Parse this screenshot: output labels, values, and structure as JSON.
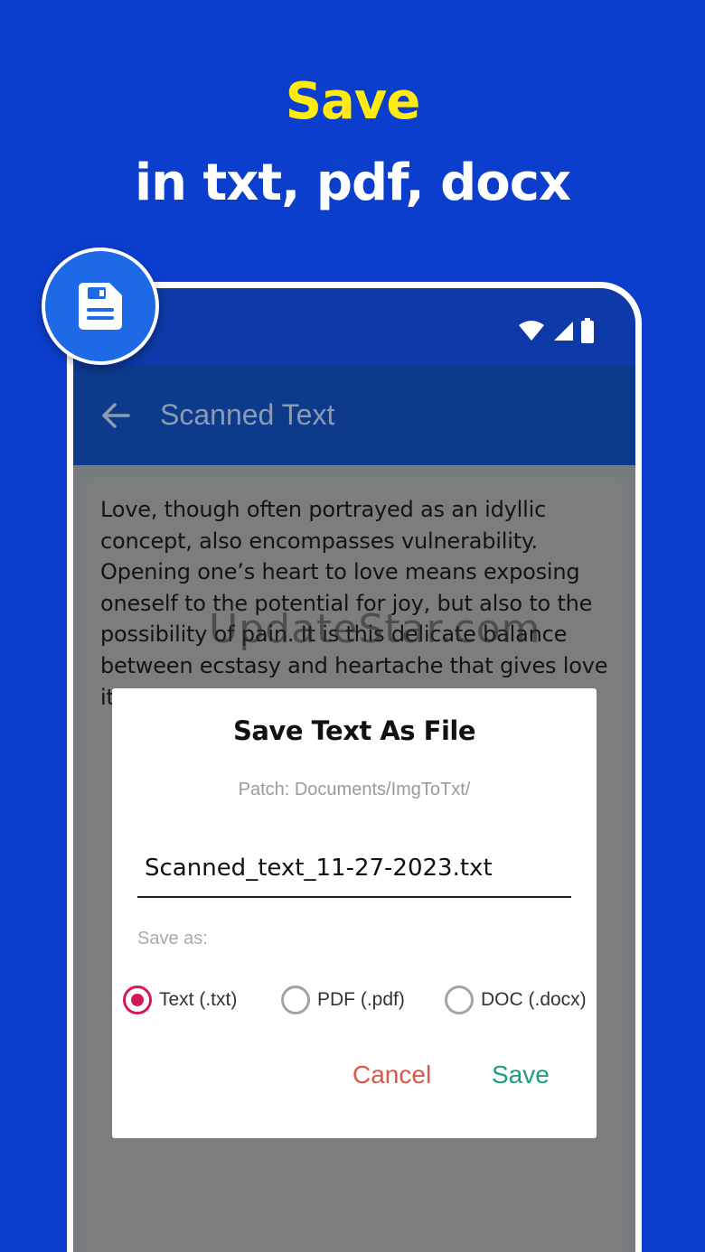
{
  "headline": {
    "line1": "Save",
    "line2": "in txt, pdf, docx"
  },
  "icons": {
    "badge": "save-file-icon",
    "status": [
      "wifi-icon",
      "signal-icon",
      "battery-icon"
    ],
    "back": "arrow-left-icon"
  },
  "appbar": {
    "title": "Scanned Text"
  },
  "scanned_text": {
    "lines": [
      "Love, though often portrayed as an idyllic",
      "concept, also encompasses vulnerability.",
      "Opening one’s heart to love means exposing",
      "oneself to the potential for joy, but also to the",
      "possibility of pain. It is this delicate balance",
      "between ecstasy and heartache that gives love",
      "its"
    ]
  },
  "watermark": "UpdateStar.com",
  "dialog": {
    "title": "Save Text As File",
    "path": "Patch: Documents/ImgToTxt/",
    "filename": "Scanned_text_11-27-2023.txt",
    "save_as_label": "Save as:",
    "options": [
      {
        "label": "Text (.txt)",
        "selected": true
      },
      {
        "label": "PDF (.pdf)",
        "selected": false
      },
      {
        "label": "DOC (.docx)",
        "selected": false
      }
    ],
    "cancel_label": "Cancel",
    "save_label": "Save"
  },
  "colors": {
    "background": "#0B3ECC",
    "headline_accent": "#FFEB0F",
    "status_bar": "#0D3AA8",
    "appbar": "#0E3A8B",
    "radio_selected": "#D6175B",
    "cancel": "#E0554A",
    "save": "#1E9C82",
    "badge": "#1E6AE6"
  }
}
